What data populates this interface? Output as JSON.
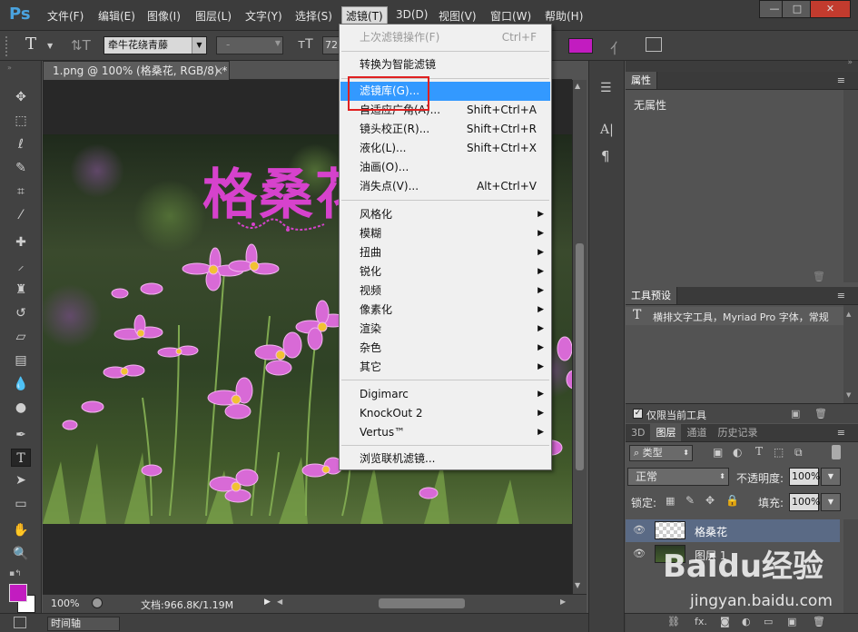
{
  "app": {
    "logo": "Ps"
  },
  "menubar": {
    "items": [
      "文件(F)",
      "编辑(E)",
      "图像(I)",
      "图层(L)",
      "文字(Y)",
      "选择(S)",
      "滤镜(T)",
      "3D(D)",
      "视图(V)",
      "窗口(W)",
      "帮助(H)"
    ],
    "window_buttons": [
      "—",
      "□",
      "✕"
    ]
  },
  "options_bar": {
    "tool_icon": "T",
    "font_family": "牵牛花绕青藤",
    "font_style": "-",
    "font_size": "72",
    "text_color": "#c21cc0"
  },
  "document": {
    "tab_title": "1.png @ 100% (格桑花, RGB/8) *",
    "tab_close": "×",
    "overlay_text": "格桑花"
  },
  "statusbar": {
    "zoom": "100%",
    "doc_info": "文档:966.8K/1.19M"
  },
  "timeline": {
    "label": "时间轴"
  },
  "filter_menu": {
    "items": [
      {
        "label": "上次滤镜操作(F)",
        "shortcut": "Ctrl+F",
        "disabled": true
      },
      {
        "label": "转换为智能滤镜"
      },
      {
        "label": "滤镜库(G)...",
        "highlighted": true
      },
      {
        "label": "自适应广角(A)...",
        "shortcut": "Shift+Ctrl+A"
      },
      {
        "label": "镜头校正(R)...",
        "shortcut": "Shift+Ctrl+R"
      },
      {
        "label": "液化(L)...",
        "shortcut": "Shift+Ctrl+X"
      },
      {
        "label": "油画(O)..."
      },
      {
        "label": "消失点(V)...",
        "shortcut": "Alt+Ctrl+V"
      },
      {
        "label": "风格化",
        "submenu": true
      },
      {
        "label": "模糊",
        "submenu": true
      },
      {
        "label": "扭曲",
        "submenu": true
      },
      {
        "label": "锐化",
        "submenu": true
      },
      {
        "label": "视频",
        "submenu": true
      },
      {
        "label": "像素化",
        "submenu": true
      },
      {
        "label": "渲染",
        "submenu": true
      },
      {
        "label": "杂色",
        "submenu": true
      },
      {
        "label": "其它",
        "submenu": true
      },
      {
        "label": "Digimarc",
        "submenu": true
      },
      {
        "label": "KnockOut 2",
        "submenu": true
      },
      {
        "label": "Vertus™",
        "submenu": true
      },
      {
        "label": "浏览联机滤镜..."
      }
    ]
  },
  "properties_panel": {
    "tab": "属性",
    "body": "无属性"
  },
  "tool_presets_panel": {
    "tab": "工具预设",
    "entry": "横排文字工具，Myriad Pro 字体，常规",
    "checkbox_label": "仅限当前工具"
  },
  "layers_panel": {
    "tabs": [
      "3D",
      "图层",
      "通道",
      "历史记录"
    ],
    "filter_kind": "类型",
    "blend_mode": "正常",
    "opacity_label": "不透明度:",
    "opacity_value": "100%",
    "lock_label": "锁定:",
    "fill_label": "填充:",
    "fill_value": "100%",
    "layers": [
      {
        "name": "格桑花",
        "selected": true
      },
      {
        "name": "图层 1",
        "selected": false
      }
    ]
  },
  "watermark": {
    "brand": "Baidu经验",
    "url": "jingyan.baidu.com"
  },
  "colors": {
    "accent": "#3399ff",
    "highlight_box": "#e02020",
    "foreground_color": "#c21cc0",
    "text_magenta": "#d642cc"
  },
  "icons": [
    "move-icon",
    "marquee-icon",
    "lasso-icon",
    "quick-select-icon",
    "crop-icon",
    "eyedropper-icon",
    "healing-icon",
    "brush-icon",
    "stamp-icon",
    "history-brush-icon",
    "eraser-icon",
    "gradient-icon",
    "blur-icon",
    "dodge-icon",
    "pen-icon",
    "type-icon",
    "path-select-icon",
    "rectangle-icon",
    "hand-icon",
    "zoom-icon"
  ]
}
